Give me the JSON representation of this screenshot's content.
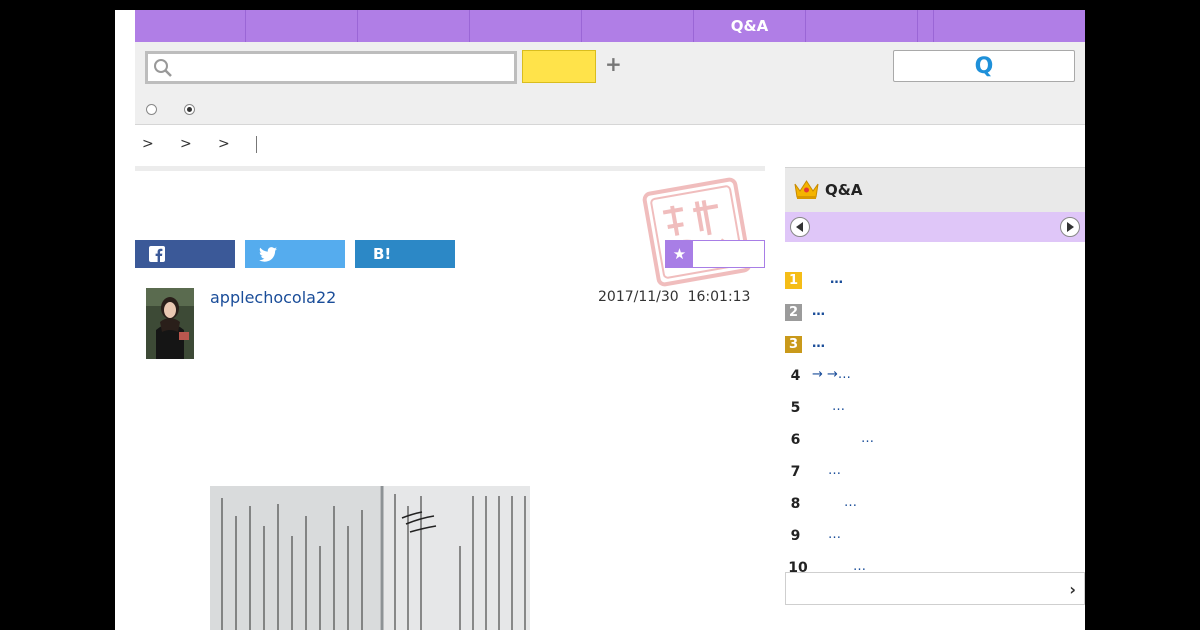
{
  "nav": {
    "items": [
      "",
      "",
      "",
      "",
      "",
      "Q&A",
      "",
      "",
      ""
    ]
  },
  "search": {
    "placeholder": "",
    "button_label": "",
    "plus": "+",
    "ask_label": "Q"
  },
  "breadcrumb": {
    "separators": [
      ">",
      ">",
      ">"
    ]
  },
  "share": {
    "facebook": "f",
    "twitter": "",
    "hatena": "B!"
  },
  "bookmark": {
    "star": "★"
  },
  "post": {
    "username": "applechocola22",
    "date": "2017/11/30  16:01:13"
  },
  "ranking": {
    "title": "Q&A",
    "items": [
      {
        "rank": "1",
        "text": "…",
        "style": "gold"
      },
      {
        "rank": "2",
        "text": "…",
        "style": "silver"
      },
      {
        "rank": "3",
        "text": "…",
        "style": "bronze"
      },
      {
        "rank": "4",
        "text": "→  →…",
        "style": "plain"
      },
      {
        "rank": "5",
        "text": "…",
        "style": "plain"
      },
      {
        "rank": "6",
        "text": "…",
        "style": "plain"
      },
      {
        "rank": "7",
        "text": "…",
        "style": "plain"
      },
      {
        "rank": "8",
        "text": "…",
        "style": "plain"
      },
      {
        "rank": "9",
        "text": "…",
        "style": "plain"
      },
      {
        "rank": "10",
        "text": "…",
        "style": "plain"
      }
    ],
    "more_chevron": "›"
  },
  "colors": {
    "nav_purple": "#b07ee6",
    "search_yellow": "#ffe34a",
    "facebook": "#3b5998",
    "twitter": "#55acee",
    "hatena": "#2c88c6",
    "link_blue": "#1a4d99"
  }
}
